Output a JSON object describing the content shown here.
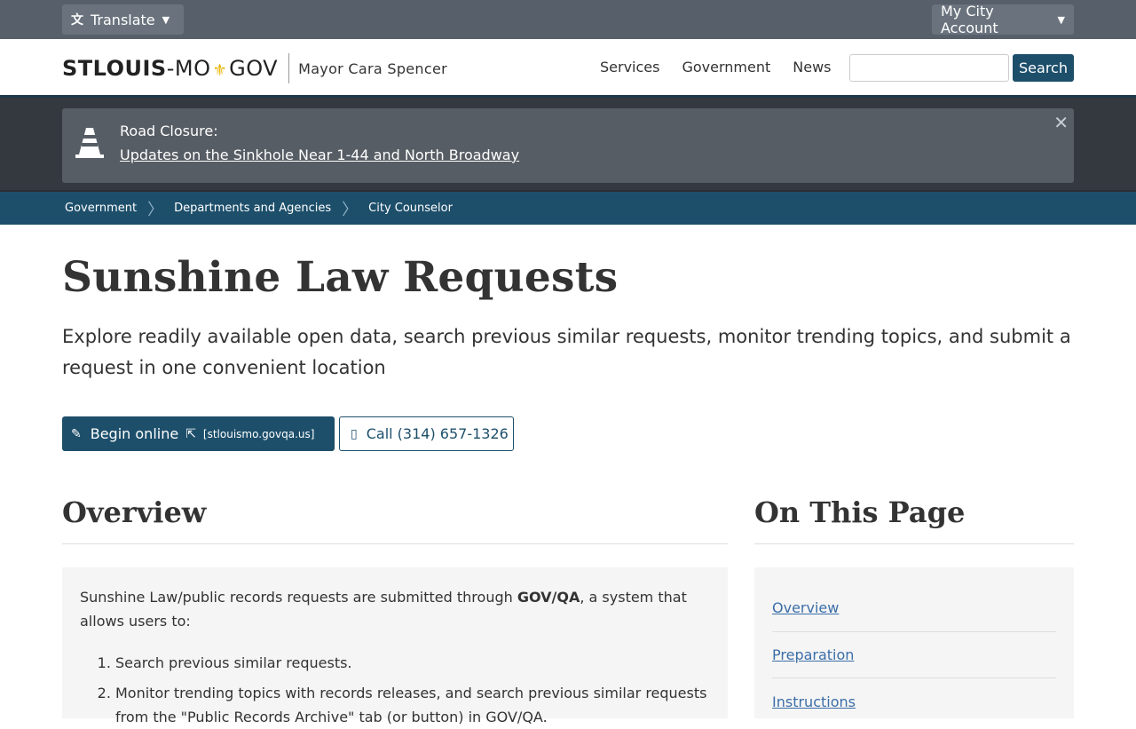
{
  "utility": {
    "translate_label": "Translate",
    "account_label": "My City Account"
  },
  "header": {
    "logo_part1": "STLOUIS",
    "logo_part2": "-MO",
    "logo_part3": "GOV",
    "mayor": "Mayor Cara Spencer",
    "nav": [
      {
        "label": "Services"
      },
      {
        "label": "Government"
      },
      {
        "label": "News"
      }
    ],
    "search_placeholder": "",
    "search_button": "Search"
  },
  "alert": {
    "title": "Road Closure:",
    "link_text": "Updates on the Sinkhole Near 1-44 and North Broadway",
    "close": "✕"
  },
  "breadcrumb": [
    {
      "label": "Government"
    },
    {
      "label": "Departments and Agencies"
    },
    {
      "label": "City Counselor"
    }
  ],
  "page": {
    "title": "Sunshine Law Requests",
    "lead": "Explore readily available open data, search previous similar requests, monitor trending topics, and submit a request in one convenient location",
    "begin_label": "Begin online",
    "begin_domain": "[stlouismo.govqa.us]",
    "call_label": "Call (314) 657-1326"
  },
  "overview": {
    "heading": "Overview",
    "intro_before": "Sunshine Law/public records requests are submitted through ",
    "intro_bold": "GOV/QA",
    "intro_after": ", a system that allows users to:",
    "items": [
      {
        "text": "Search previous similar requests."
      },
      {
        "text": "Monitor trending topics with records releases, and search previous similar requests from the \"Public Records Archive\" tab (or button) in GOV/QA."
      }
    ]
  },
  "toc": {
    "heading": "On This Page",
    "items": [
      {
        "label": "Overview"
      },
      {
        "label": "Preparation"
      },
      {
        "label": "Instructions"
      }
    ]
  },
  "colors": {
    "brand_dark": "#1d4f6b",
    "utility_bg": "#565f6a",
    "alert_bg": "#575d64",
    "link": "#3b6ea8"
  }
}
